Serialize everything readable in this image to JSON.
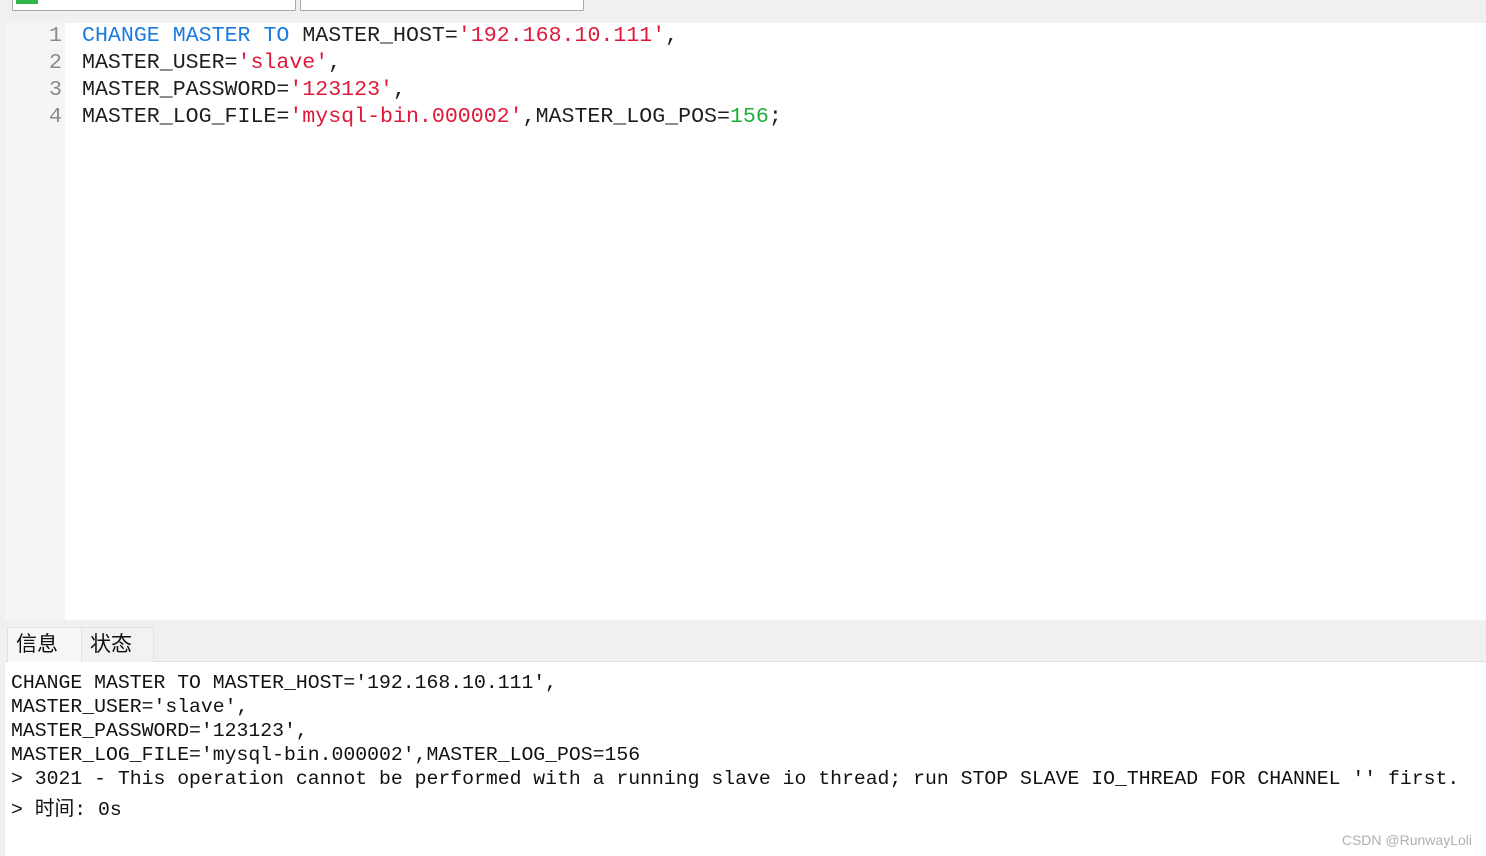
{
  "editor": {
    "lines": [
      {
        "n": "1",
        "parts": [
          "CHANGE",
          " ",
          "MASTER",
          " ",
          "TO",
          " MASTER_HOST=",
          "'192.168.10.111'",
          ","
        ]
      },
      {
        "n": "2",
        "parts": [
          "MASTER_USER=",
          "'slave'",
          ","
        ]
      },
      {
        "n": "3",
        "parts": [
          "MASTER_PASSWORD=",
          "'123123'",
          ","
        ]
      },
      {
        "n": "4",
        "parts": [
          "MASTER_LOG_FILE=",
          "'mysql-bin.000002'",
          ",MASTER_LOG_POS=",
          "156",
          ";"
        ]
      }
    ]
  },
  "tabs": [
    {
      "label": "信息"
    },
    {
      "label": "状态"
    }
  ],
  "output": {
    "lines": [
      "CHANGE MASTER TO MASTER_HOST='192.168.10.111',",
      "MASTER_USER='slave',",
      "MASTER_PASSWORD='123123',",
      "MASTER_LOG_FILE='mysql-bin.000002',MASTER_LOG_POS=156",
      "> 3021 - This operation cannot be performed with a running slave io thread; run STOP SLAVE IO_THREAD FOR CHANNEL '' first.",
      "> 时间: 0s"
    ]
  },
  "watermark": "CSDN @RunwayLoli",
  "colors": {
    "keyword": "#1a7ae0",
    "string": "#e0193a",
    "number": "#1fae3a"
  }
}
